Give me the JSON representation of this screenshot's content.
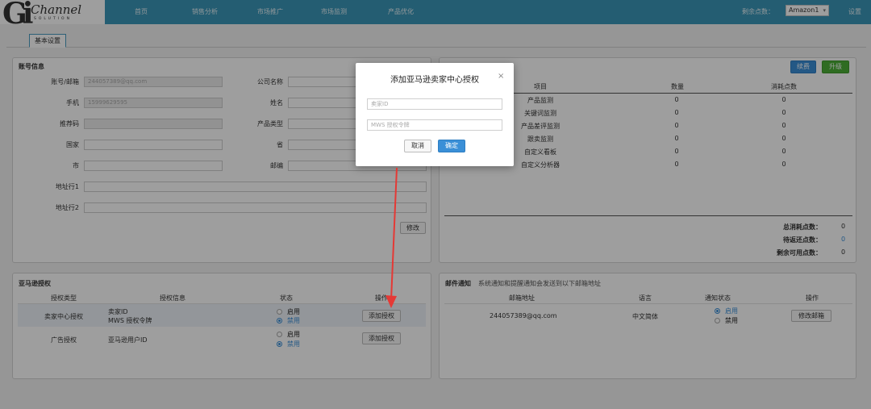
{
  "brand": {
    "logo_letters": "Gi",
    "logo_word": "Channel",
    "logo_sub": "SOLUTION"
  },
  "nav": {
    "items": [
      "首页",
      "销售分析",
      "市场推广",
      "市场监测",
      "产品优化"
    ],
    "points_label": "剩余点数：",
    "market_value": "Amazon1",
    "settings_label": "设置"
  },
  "tab": {
    "label": "基本设置"
  },
  "account": {
    "title": "账号信息",
    "fields": [
      {
        "label": "账号/邮箱",
        "value": "244057389@qq.com",
        "readonly": true
      },
      {
        "label": "公司名称",
        "value": ""
      },
      {
        "label": "手机",
        "value": "15999629595",
        "readonly": true
      },
      {
        "label": "姓名",
        "value": ""
      },
      {
        "label": "推荐码",
        "value": "",
        "readonly": true
      },
      {
        "label": "产品类型",
        "value": ""
      },
      {
        "label": "国家",
        "value": ""
      },
      {
        "label": "省",
        "value": ""
      },
      {
        "label": "市",
        "value": ""
      },
      {
        "label": "邮编",
        "value": ""
      },
      {
        "label": "地址行1",
        "value": ""
      },
      {
        "label": "地址行2",
        "value": ""
      }
    ],
    "save_label": "修改"
  },
  "points": {
    "renew_label": "续费",
    "upgrade_label": "升级",
    "headers": [
      "项目",
      "数量",
      "消耗点数"
    ],
    "rows": [
      [
        "产品监测",
        "0",
        "0"
      ],
      [
        "关键词监测",
        "0",
        "0"
      ],
      [
        "产品差评监测",
        "0",
        "0"
      ],
      [
        "跟卖监测",
        "0",
        "0"
      ],
      [
        "自定义看板",
        "0",
        "0"
      ],
      [
        "自定义分析器",
        "0",
        "0"
      ]
    ],
    "total_label": "总消耗点数：",
    "total_value": "0",
    "pending_label": "待返还点数：",
    "pending_value": "0",
    "remaining_label": "剩余可用点数：",
    "remaining_value": "0"
  },
  "amazon_auth": {
    "title": "亚马逊授权",
    "headers": [
      "授权类型",
      "授权信息",
      "状态",
      "操作"
    ],
    "rows": [
      {
        "type": "卖家中心授权",
        "info_line1": "卖家ID",
        "info_line2": "MWS 授权令牌",
        "enable": "启用",
        "disable": "禁用",
        "action": "添加授权"
      },
      {
        "type": "广告授权",
        "info_line1": "亚马逊用户ID",
        "enable": "启用",
        "disable": "禁用",
        "action": "添加授权"
      }
    ]
  },
  "mail": {
    "title": "邮件通知",
    "note": "系统通知和提醒通知会发送到以下邮箱地址",
    "headers": [
      "邮箱地址",
      "语言",
      "通知状态",
      "操作"
    ],
    "row": {
      "email": "244057389@qq.com",
      "language": "中文简体",
      "enable": "启用",
      "disable": "禁用",
      "action": "修改邮箱"
    }
  },
  "modal": {
    "title": "添加亚马逊卖家中心授权",
    "close": "×",
    "seller_id_placeholder": "卖家ID",
    "token_placeholder": "MWS 授权令牌",
    "cancel_label": "取消",
    "confirm_label": "确定"
  },
  "colors": {
    "nav_bg": "#3b97b9",
    "primary": "#3a8fd7",
    "green": "#4caf38",
    "arrow": "#e53935"
  }
}
